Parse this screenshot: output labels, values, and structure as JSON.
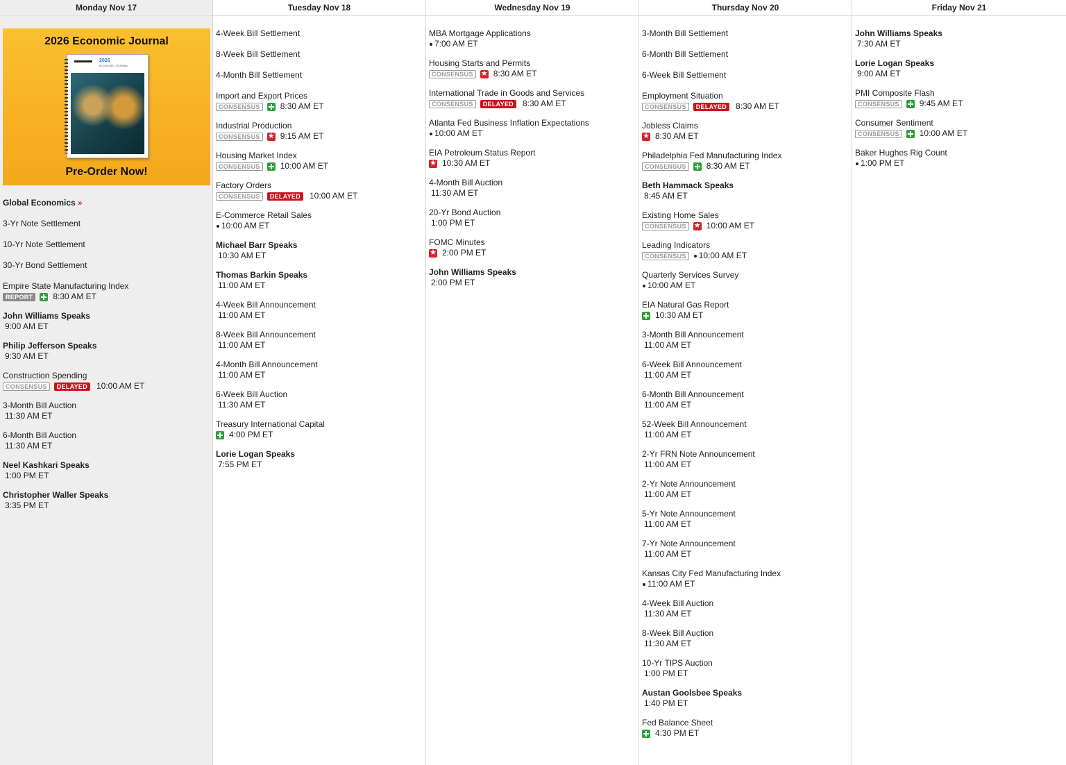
{
  "days": [
    {
      "label": "Monday Nov 17",
      "today": true,
      "promo": {
        "title": "2026 Economic Journal",
        "cta": "Pre-Order Now!",
        "book_title": "2026",
        "book_sub": "ECONOMIC JOURNAL"
      },
      "global_link": {
        "label": "Global Economics",
        "arrow": "»"
      },
      "events": [
        {
          "name": "3-Yr Note Settlement"
        },
        {
          "name": "10-Yr Note Settlement"
        },
        {
          "name": "30-Yr Bond Settlement"
        },
        {
          "name": "Empire State Manufacturing Index",
          "badges": [
            "REPORT"
          ],
          "icon": "green",
          "time": "8:30 AM ET"
        },
        {
          "name": "John Williams Speaks",
          "bold": true,
          "time": "9:00 AM ET"
        },
        {
          "name": "Philip Jefferson Speaks",
          "bold": true,
          "time": "9:30 AM ET"
        },
        {
          "name": "Construction Spending",
          "badges": [
            "CONSENSUS",
            "DELAYED"
          ],
          "time": "10:00 AM ET"
        },
        {
          "name": "3-Month Bill Auction",
          "time": "11:30 AM ET"
        },
        {
          "name": "6-Month Bill Auction",
          "time": "11:30 AM ET"
        },
        {
          "name": "Neel Kashkari Speaks",
          "bold": true,
          "time": "1:00 PM ET"
        },
        {
          "name": "Christopher Waller Speaks",
          "bold": true,
          "time": "3:35 PM ET"
        }
      ]
    },
    {
      "label": "Tuesday Nov 18",
      "events": [
        {
          "name": "4-Week Bill Settlement"
        },
        {
          "name": "8-Week Bill Settlement"
        },
        {
          "name": "4-Month Bill Settlement"
        },
        {
          "name": "Import and Export Prices",
          "badges": [
            "CONSENSUS"
          ],
          "icon": "green",
          "time": "8:30 AM ET"
        },
        {
          "name": "Industrial Production",
          "badges": [
            "CONSENSUS"
          ],
          "icon": "red",
          "time": "9:15 AM ET"
        },
        {
          "name": "Housing Market Index",
          "badges": [
            "CONSENSUS"
          ],
          "icon": "green",
          "time": "10:00 AM ET"
        },
        {
          "name": "Factory Orders",
          "badges": [
            "CONSENSUS",
            "DELAYED"
          ],
          "time": "10:00 AM ET"
        },
        {
          "name": "E-Commerce Retail Sales",
          "dot": true,
          "time": "10:00 AM ET"
        },
        {
          "name": "Michael Barr Speaks",
          "bold": true,
          "time": "10:30 AM ET"
        },
        {
          "name": "Thomas Barkin Speaks",
          "bold": true,
          "time": "11:00 AM ET"
        },
        {
          "name": "4-Week Bill Announcement",
          "time": "11:00 AM ET"
        },
        {
          "name": "8-Week Bill Announcement",
          "time": "11:00 AM ET"
        },
        {
          "name": "4-Month Bill Announcement",
          "time": "11:00 AM ET"
        },
        {
          "name": "6-Week Bill Auction",
          "time": "11:30 AM ET"
        },
        {
          "name": "Treasury International Capital",
          "icon": "green",
          "time": "4:00 PM ET"
        },
        {
          "name": "Lorie Logan Speaks",
          "bold": true,
          "time": "7:55 PM ET"
        }
      ]
    },
    {
      "label": "Wednesday Nov 19",
      "events": [
        {
          "name": "MBA Mortgage Applications",
          "dot": true,
          "time": "7:00 AM ET"
        },
        {
          "name": "Housing Starts and Permits",
          "badges": [
            "CONSENSUS"
          ],
          "icon": "red",
          "time": "8:30 AM ET"
        },
        {
          "name": "International Trade in Goods and Services",
          "badges": [
            "CONSENSUS",
            "DELAYED"
          ],
          "time": "8:30 AM ET"
        },
        {
          "name": "Atlanta Fed Business Inflation Expectations",
          "dot": true,
          "time": "10:00 AM ET"
        },
        {
          "name": "EIA Petroleum Status Report",
          "icon": "red",
          "time": "10:30 AM ET"
        },
        {
          "name": "4-Month Bill Auction",
          "time": "11:30 AM ET"
        },
        {
          "name": "20-Yr Bond Auction",
          "time": "1:00 PM ET"
        },
        {
          "name": "FOMC Minutes",
          "icon": "red",
          "time": "2:00 PM ET"
        },
        {
          "name": "John Williams Speaks",
          "bold": true,
          "time": "2:00 PM ET"
        }
      ]
    },
    {
      "label": "Thursday Nov 20",
      "events": [
        {
          "name": "3-Month Bill Settlement"
        },
        {
          "name": "6-Month Bill Settlement"
        },
        {
          "name": "6-Week Bill Settlement"
        },
        {
          "name": "Employment Situation",
          "badges": [
            "CONSENSUS",
            "DELAYED"
          ],
          "time": "8:30 AM ET"
        },
        {
          "name": "Jobless Claims",
          "icon": "red",
          "time": "8:30 AM ET"
        },
        {
          "name": "Philadelphia Fed Manufacturing Index",
          "badges": [
            "CONSENSUS"
          ],
          "icon": "green",
          "time": "8:30 AM ET"
        },
        {
          "name": "Beth Hammack Speaks",
          "bold": true,
          "time": "8:45 AM ET"
        },
        {
          "name": "Existing Home Sales",
          "badges": [
            "CONSENSUS"
          ],
          "icon": "red",
          "time": "10:00 AM ET"
        },
        {
          "name": "Leading Indicators",
          "badges": [
            "CONSENSUS"
          ],
          "dot": true,
          "time": "10:00 AM ET"
        },
        {
          "name": "Quarterly Services Survey",
          "dot": true,
          "time": "10:00 AM ET"
        },
        {
          "name": "EIA Natural Gas Report",
          "icon": "green",
          "time": "10:30 AM ET"
        },
        {
          "name": "3-Month Bill Announcement",
          "time": "11:00 AM ET"
        },
        {
          "name": "6-Week Bill Announcement",
          "time": "11:00 AM ET"
        },
        {
          "name": "6-Month Bill Announcement",
          "time": "11:00 AM ET"
        },
        {
          "name": "52-Week Bill Announcement",
          "time": "11:00 AM ET"
        },
        {
          "name": "2-Yr FRN Note Announcement",
          "time": "11:00 AM ET"
        },
        {
          "name": "2-Yr Note Announcement",
          "time": "11:00 AM ET"
        },
        {
          "name": "5-Yr Note Announcement",
          "time": "11:00 AM ET"
        },
        {
          "name": "7-Yr Note Announcement",
          "time": "11:00 AM ET"
        },
        {
          "name": "Kansas City Fed Manufacturing Index",
          "dot": true,
          "time": "11:00 AM ET"
        },
        {
          "name": "4-Week Bill Auction",
          "time": "11:30 AM ET"
        },
        {
          "name": "8-Week Bill Auction",
          "time": "11:30 AM ET"
        },
        {
          "name": "10-Yr TIPS Auction",
          "time": "1:00 PM ET"
        },
        {
          "name": "Austan Goolsbee Speaks",
          "bold": true,
          "time": "1:40 PM ET"
        },
        {
          "name": "Fed Balance Sheet",
          "icon": "green",
          "time": "4:30 PM ET"
        }
      ]
    },
    {
      "label": "Friday Nov 21",
      "events": [
        {
          "name": "John Williams Speaks",
          "bold": true,
          "time": "7:30 AM ET"
        },
        {
          "name": "Lorie Logan Speaks",
          "bold": true,
          "time": "9:00 AM ET"
        },
        {
          "name": "PMI Composite Flash",
          "badges": [
            "CONSENSUS"
          ],
          "icon": "green",
          "time": "9:45 AM ET"
        },
        {
          "name": "Consumer Sentiment",
          "badges": [
            "CONSENSUS"
          ],
          "icon": "green",
          "time": "10:00 AM ET"
        },
        {
          "name": "Baker Hughes Rig Count",
          "dot": true,
          "time": "1:00 PM ET"
        }
      ]
    }
  ],
  "colors": {
    "today_bg": "#eeeeee",
    "delayed": "#c8141c",
    "green_icon": "#2f9e3a",
    "red_icon": "#d2232a",
    "promo": "#f8b424"
  },
  "icons": {
    "green": "plus-icon",
    "red": "star-icon",
    "dot": "bullet-icon"
  }
}
